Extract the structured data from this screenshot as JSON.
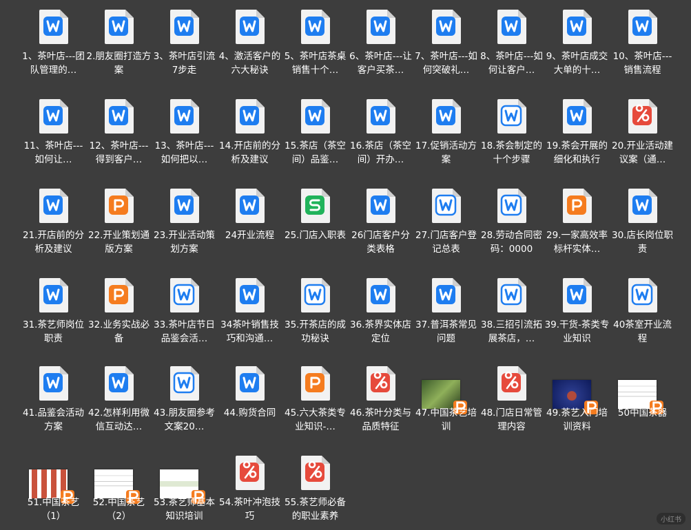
{
  "colors": {
    "background": "#3d3d3d",
    "word": "#1e7df0",
    "word_outline": "#1e7df0",
    "ppt_orange": "#f57c1f",
    "pdf_red": "#e64a3c",
    "excel_green": "#21b35b",
    "text": "#ffffff"
  },
  "files": [
    {
      "label": "1、茶叶店---团队管理的…",
      "icon": "word-icon"
    },
    {
      "label": "2.朋友圈打造方案",
      "icon": "word-icon"
    },
    {
      "label": "3、茶叶店引流7步走",
      "icon": "word-icon"
    },
    {
      "label": "4、激活客户的六大秘诀",
      "icon": "word-icon"
    },
    {
      "label": "5、茶叶店茶桌销售十个…",
      "icon": "word-icon"
    },
    {
      "label": "6、茶叶店---让客户买茶…",
      "icon": "word-icon"
    },
    {
      "label": "7、茶叶店---如何突破礼…",
      "icon": "word-icon"
    },
    {
      "label": "8、茶叶店---如何让客户…",
      "icon": "word-icon"
    },
    {
      "label": "9、茶叶店成交大单的十…",
      "icon": "word-icon"
    },
    {
      "label": "10、茶叶店---销售流程",
      "icon": "word-icon"
    },
    {
      "label": "11、茶叶店---如何让…",
      "icon": "word-icon"
    },
    {
      "label": "12、茶叶店---得到客户…",
      "icon": "word-icon"
    },
    {
      "label": "13、茶叶店---如何把以…",
      "icon": "word-icon"
    },
    {
      "label": "14.开店前的分析及建议",
      "icon": "word-icon"
    },
    {
      "label": "15.茶店（茶空间）品鉴…",
      "icon": "word-icon"
    },
    {
      "label": "16.茶店（茶空间）开办…",
      "icon": "word-icon"
    },
    {
      "label": "17.促销活动方案",
      "icon": "word-icon"
    },
    {
      "label": "18.茶会制定的十个步骤",
      "icon": "word-outline-icon"
    },
    {
      "label": "19.茶会开展的细化和执行",
      "icon": "word-icon"
    },
    {
      "label": "20.开业活动建议案（通…",
      "icon": "pdf-icon"
    },
    {
      "label": "21.开店前的分析及建议",
      "icon": "word-icon"
    },
    {
      "label": "22.开业策划通版方案",
      "icon": "ppt-icon"
    },
    {
      "label": "23.开业活动策划方案",
      "icon": "word-icon"
    },
    {
      "label": "24开业流程",
      "icon": "word-icon"
    },
    {
      "label": "25.门店入职表",
      "icon": "excel-icon"
    },
    {
      "label": "26门店客户分类表格",
      "icon": "word-icon"
    },
    {
      "label": "27.门店客户登记总表",
      "icon": "word-outline-icon"
    },
    {
      "label": "28.劳动合同密码：0000",
      "icon": "word-outline-icon"
    },
    {
      "label": "29.一家高效率标杆实体…",
      "icon": "ppt-icon"
    },
    {
      "label": "30.店长岗位职责",
      "icon": "word-icon"
    },
    {
      "label": "31.茶艺师岗位职责",
      "icon": "word-icon"
    },
    {
      "label": "32.业务实战必备",
      "icon": "ppt-icon"
    },
    {
      "label": "33.茶叶店节日品鉴会活…",
      "icon": "word-outline-icon"
    },
    {
      "label": "34茶叶销售技巧和沟通…",
      "icon": "word-icon"
    },
    {
      "label": "35.开茶店的成功秘诀",
      "icon": "word-outline-icon"
    },
    {
      "label": "36.茶界实体店定位",
      "icon": "word-icon"
    },
    {
      "label": "37.普洱茶常见问题",
      "icon": "word-icon"
    },
    {
      "label": "38.三招引流拓展茶店，…",
      "icon": "word-outline-icon"
    },
    {
      "label": "39.干货-茶类专业知识",
      "icon": "word-icon"
    },
    {
      "label": "40茶室开业流程",
      "icon": "word-outline-icon"
    },
    {
      "label": "41.品鉴会活动方案",
      "icon": "word-icon"
    },
    {
      "label": "42.怎样利用微信互动达…",
      "icon": "word-icon"
    },
    {
      "label": "43.朋友圈参考文案20…",
      "icon": "word-outline-icon"
    },
    {
      "label": "44.购货合同",
      "icon": "word-icon"
    },
    {
      "label": "45.六大茶类专业知识-…",
      "icon": "ppt-icon"
    },
    {
      "label": "46.茶叶分类与品质特征",
      "icon": "pdf-icon"
    },
    {
      "label": "47.中国茶艺培训",
      "icon": "thumb-tea-icon"
    },
    {
      "label": "48.门店日常管理内容",
      "icon": "pdf-icon"
    },
    {
      "label": "49.茶艺入门培训资料",
      "icon": "thumb-blue-icon"
    },
    {
      "label": "50中国茶器",
      "icon": "thumb-doc-icon"
    },
    {
      "label": "51.中国茶艺（1）",
      "icon": "thumb-people-icon"
    },
    {
      "label": "52.中国茶艺（2）",
      "icon": "thumb-doc-icon"
    },
    {
      "label": "53.茶艺师基本知识培训",
      "icon": "thumb-plant-icon"
    },
    {
      "label": "54.茶叶冲泡技巧",
      "icon": "pdf-icon"
    },
    {
      "label": "55.茶艺师必备的职业素养",
      "icon": "pdf-icon"
    }
  ],
  "watermark": "小红书"
}
